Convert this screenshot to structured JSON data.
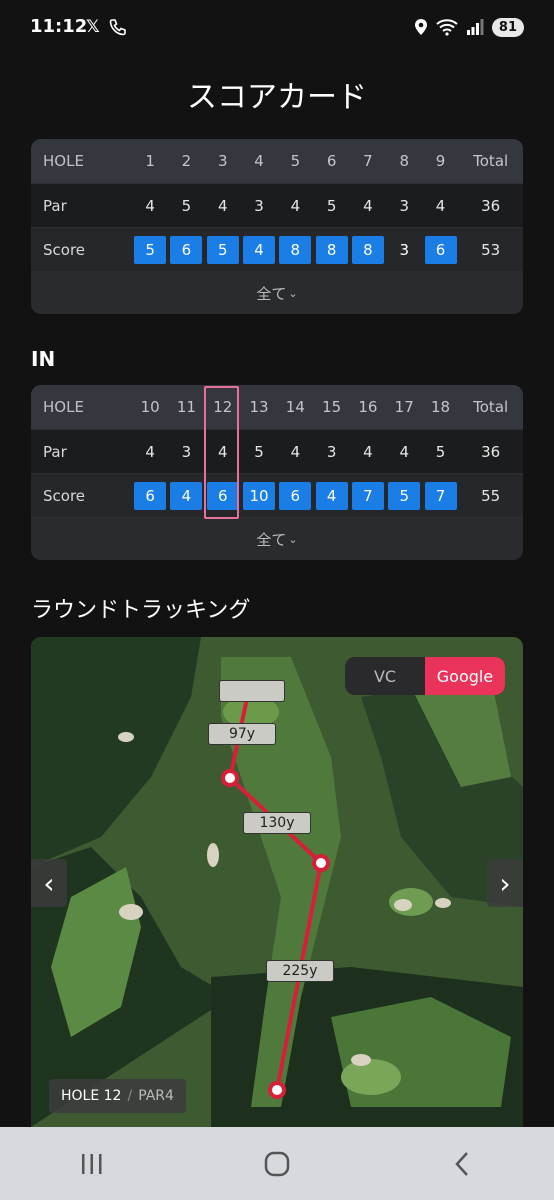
{
  "status": {
    "time": "11:12",
    "x_label": "𝕏",
    "battery": "81"
  },
  "page_title": "スコアカード",
  "out_table": {
    "header_label": "HOLE",
    "holes": [
      "1",
      "2",
      "3",
      "4",
      "5",
      "6",
      "7",
      "8",
      "9"
    ],
    "total_label": "Total",
    "par_label": "Par",
    "par": [
      "4",
      "5",
      "4",
      "3",
      "4",
      "5",
      "4",
      "3",
      "4"
    ],
    "par_total": "36",
    "score_label": "Score",
    "score": [
      "5",
      "6",
      "5",
      "4",
      "8",
      "8",
      "8",
      "3",
      "6"
    ],
    "score_highlighted": [
      true,
      true,
      true,
      true,
      true,
      true,
      true,
      false,
      true
    ],
    "score_total": "53",
    "expand_label": "全て"
  },
  "in_section_title": "IN",
  "in_table": {
    "header_label": "HOLE",
    "holes": [
      "10",
      "11",
      "12",
      "13",
      "14",
      "15",
      "16",
      "17",
      "18"
    ],
    "total_label": "Total",
    "par_label": "Par",
    "par": [
      "4",
      "3",
      "4",
      "5",
      "4",
      "3",
      "4",
      "4",
      "5"
    ],
    "par_total": "36",
    "score_label": "Score",
    "score": [
      "6",
      "4",
      "6",
      "10",
      "6",
      "4",
      "7",
      "5",
      "7"
    ],
    "score_highlighted": [
      true,
      true,
      true,
      true,
      true,
      true,
      true,
      true,
      true
    ],
    "score_total": "55",
    "expand_label": "全て",
    "selected_hole": "12"
  },
  "tracking_title": "ラウンドトラッキング",
  "map": {
    "toggle_options": [
      "VC",
      "Google"
    ],
    "active_toggle": "Google",
    "distances": [
      "97y",
      "130y",
      "225y"
    ],
    "hole_label": "HOLE 12",
    "par_label": "PAR4",
    "path_color": "#d81f3a"
  },
  "colors": {
    "accent_blue": "#1a7ee6",
    "accent_pink": "#e9335a",
    "highlight_border": "#e7719c"
  }
}
